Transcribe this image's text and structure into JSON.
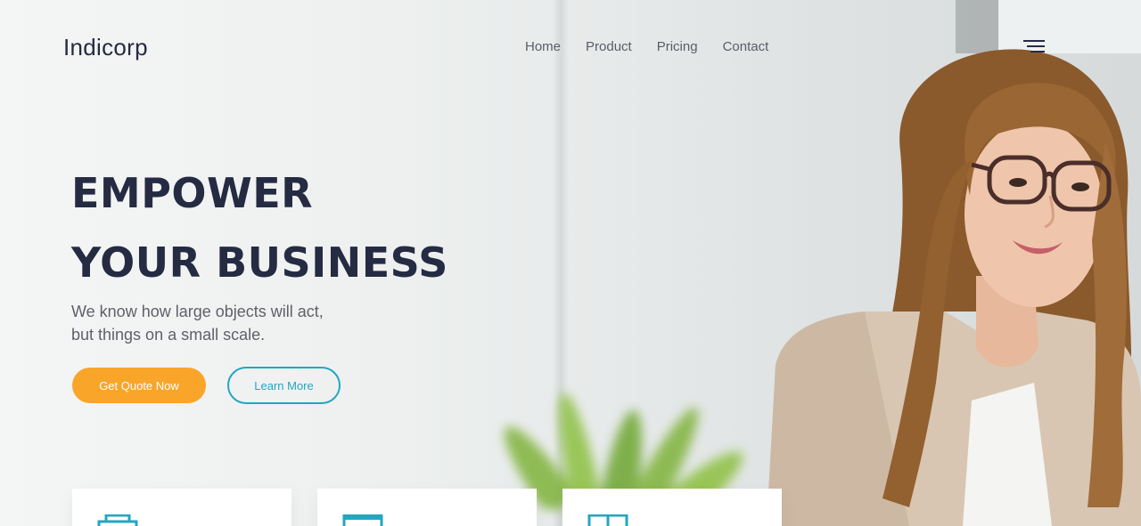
{
  "header": {
    "logo": "Indicorp",
    "nav": [
      {
        "label": "Home"
      },
      {
        "label": "Product"
      },
      {
        "label": "Pricing"
      },
      {
        "label": "Contact"
      }
    ],
    "menu_icon": "hamburger-menu-icon"
  },
  "hero": {
    "headline_line1": "EMPOWER",
    "headline_line2": "YOUR BUSINESS",
    "subtext_line1": "We know how large objects will act,",
    "subtext_line2": "but things on a small scale.",
    "primary_button": "Get Quote Now",
    "secondary_button": "Learn More"
  },
  "cards": [
    {
      "icon": "printer-icon"
    },
    {
      "icon": "monitor-icon"
    },
    {
      "icon": "layout-grid-icon"
    }
  ],
  "colors": {
    "heading": "#252b42",
    "accent_orange": "#f9a529",
    "accent_teal": "#23a6c0",
    "nav_text": "#5a5d66"
  }
}
